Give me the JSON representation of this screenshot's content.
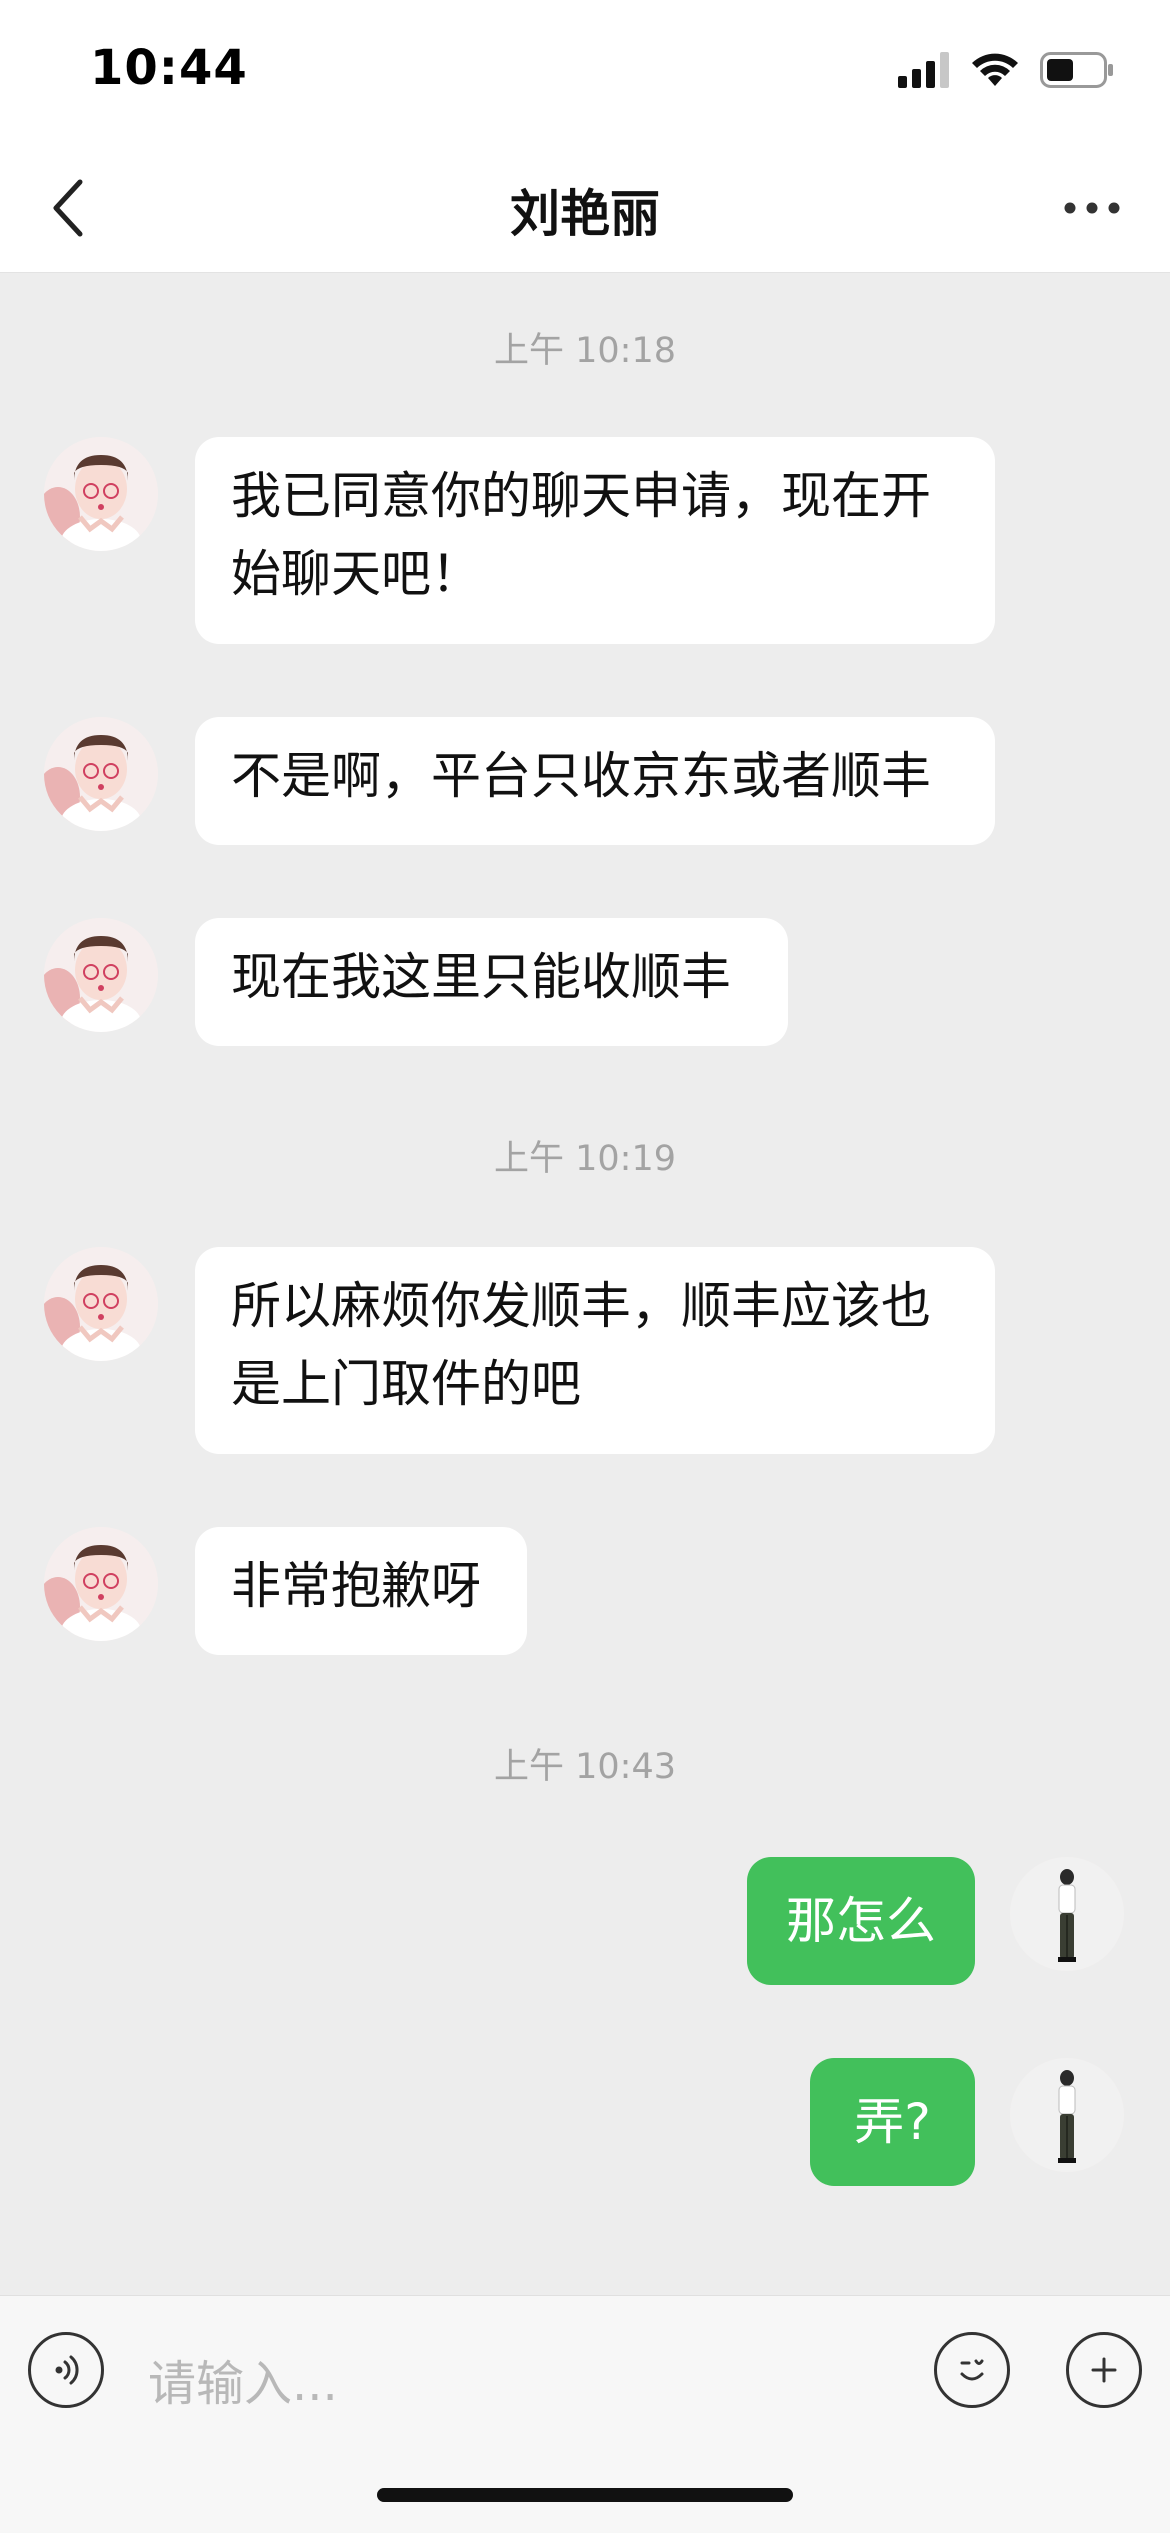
{
  "status_bar": {
    "time": "10:44",
    "icons": [
      "signal-icon",
      "wifi-icon",
      "battery-icon"
    ]
  },
  "header": {
    "title": "刘艳丽",
    "back_icon": "chevron-left-icon",
    "more_icon": "more-icon"
  },
  "messages": {
    "timestamps": [
      "上午 10:18",
      "上午 10:19",
      "上午 10:43"
    ],
    "incoming": [
      {
        "line1": "我已同意你的聊天申请，现在开",
        "line2": "始聊天吧！"
      },
      {
        "line1": "不是啊，平台只收京东或者顺丰"
      },
      {
        "line1": "现在我这里只能收顺丰"
      },
      {
        "line1": "所以麻烦你发顺丰，顺丰应该也",
        "line2": "是上门取件的吧"
      },
      {
        "line1": "非常抱歉呀"
      }
    ],
    "outgoing": [
      {
        "text": "那怎么"
      },
      {
        "text": "弄?"
      }
    ]
  },
  "input_bar": {
    "placeholder": "请输入...",
    "voice_icon": "voice-icon",
    "emoji_icon": "emoji-icon",
    "plus_icon": "plus-icon"
  },
  "colors": {
    "outgoing_bubble": "#42c05b",
    "incoming_bubble": "#ffffff",
    "chat_background": "#ededed"
  }
}
